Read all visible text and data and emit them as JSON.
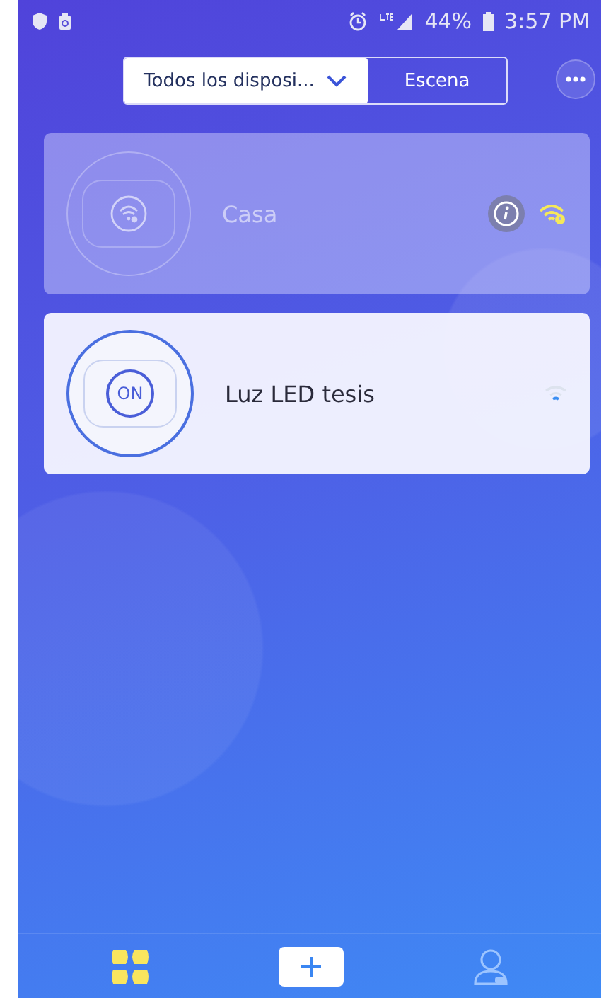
{
  "status_bar": {
    "battery": "44%",
    "time": "3:57 PM"
  },
  "filter": [
    {
      "label": "Todos los disposi...",
      "kind": "dropdown",
      "selected": true
    },
    {
      "label": "Escena",
      "kind": "tab",
      "selected": false
    }
  ],
  "devices": [
    {
      "name": "Casa",
      "online": false
    },
    {
      "name": "Luz LED tesis",
      "online": true,
      "switch_label": "ON"
    }
  ],
  "bottom_nav": [
    {
      "kind": "devices",
      "selected": true
    },
    {
      "kind": "add",
      "selected": false
    },
    {
      "kind": "profile",
      "selected": false
    }
  ]
}
